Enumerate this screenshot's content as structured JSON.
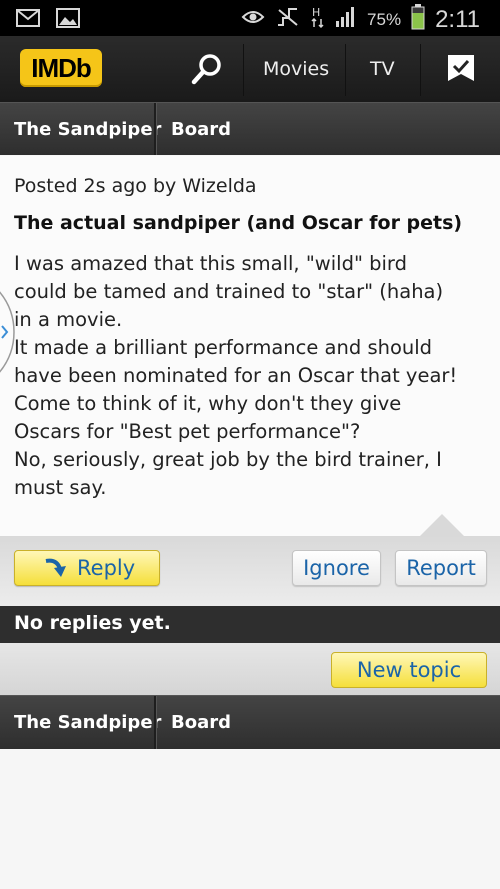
{
  "status_bar": {
    "battery_percent": "75%",
    "time": "2:11",
    "icons": [
      "email-icon",
      "image-icon",
      "eye-icon",
      "mute-icon",
      "hspa-icon",
      "signal-icon",
      "battery-icon"
    ]
  },
  "app_bar": {
    "logo": "IMDb",
    "nav": [
      "Movies",
      "TV"
    ],
    "icons": [
      "search-icon",
      "watchlist-icon"
    ]
  },
  "breadcrumb": {
    "title": "The Sandpiper",
    "section": "Board"
  },
  "post": {
    "meta": "Posted 2s ago by Wizelda",
    "subject": "The actual sandpiper (and Oscar for pets)",
    "body_lines": [
      "I was amazed that this small, \"wild\" bird",
      "could be tamed and trained to \"star\" (haha)",
      "in a movie.",
      "It made a brilliant performance and should",
      "have been nominated for an Oscar that year!",
      "Come to think of it, why don't they give",
      "Oscars for \"Best pet performance\"?",
      "No, seriously, great job by the bird trainer, I",
      "must say."
    ]
  },
  "actions": {
    "reply": "Reply",
    "ignore": "Ignore",
    "report": "Report"
  },
  "replies_status": "No replies yet.",
  "new_topic": "New topic",
  "footer_breadcrumb": {
    "title": "The Sandpiper",
    "section": "Board"
  },
  "colors": {
    "imdb_yellow": "#f5c518",
    "link_blue": "#1b64a8",
    "dark_bar": "#2e2e2e"
  }
}
